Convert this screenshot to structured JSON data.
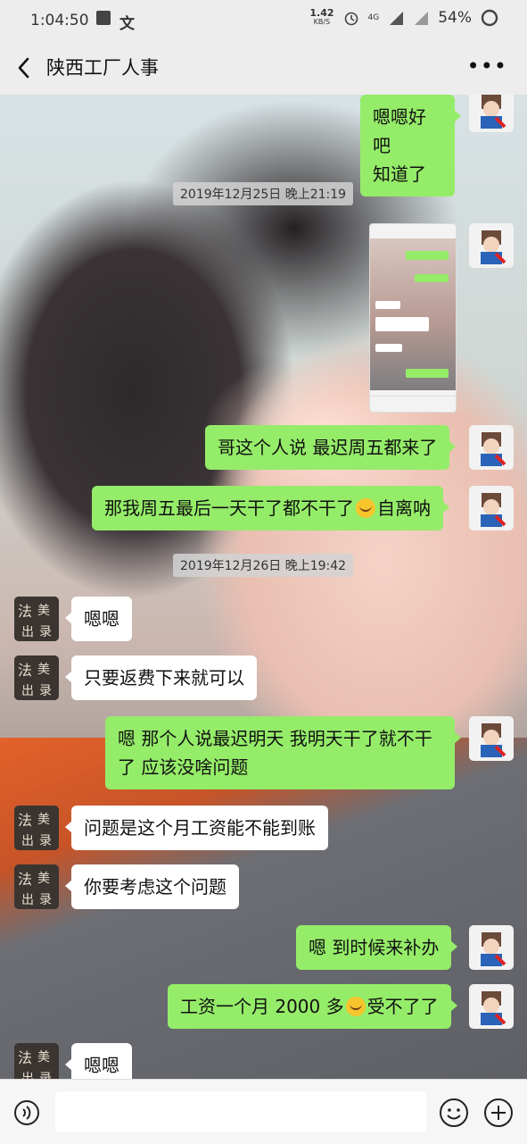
{
  "status_bar": {
    "time": "1:04:50",
    "net_speed": "1.42",
    "net_speed_unit": "KB/S",
    "network": "4G",
    "battery": "54%"
  },
  "header": {
    "title": "陕西工厂人事"
  },
  "messages": [
    {
      "type": "text",
      "side": "me",
      "lines": [
        "嗯嗯好吧",
        "知道了"
      ]
    },
    {
      "type": "timestamp",
      "text": "2019年12月25日 晚上21:19"
    },
    {
      "type": "image",
      "side": "me"
    },
    {
      "type": "text",
      "side": "me",
      "lines": [
        "哥这个人说 最迟周五都来了"
      ]
    },
    {
      "type": "text",
      "side": "me",
      "text_before_emoji": "那我周五最后一天干了都不干了",
      "text_after_emoji": "自离呐",
      "emoji": "sob-emoji"
    },
    {
      "type": "timestamp",
      "text": "2019年12月26日 晚上19:42"
    },
    {
      "type": "text",
      "side": "them",
      "lines": [
        "嗯嗯"
      ]
    },
    {
      "type": "text",
      "side": "them",
      "lines": [
        "只要返费下来就可以"
      ]
    },
    {
      "type": "text",
      "side": "me",
      "lines": [
        "嗯 那个人说最迟明天 我明天干了就不干",
        "了  应该没啥问题"
      ]
    },
    {
      "type": "text",
      "side": "them",
      "lines": [
        "问题是这个月工资能不能到账"
      ]
    },
    {
      "type": "text",
      "side": "them",
      "lines": [
        "你要考虑这个问题"
      ]
    },
    {
      "type": "text",
      "side": "me",
      "lines": [
        "嗯  到时候来补办"
      ]
    },
    {
      "type": "text",
      "side": "me",
      "text_before_emoji": "工资一个月 2000 多",
      "text_after_emoji": "受不了了",
      "emoji": "sob-emoji"
    },
    {
      "type": "text",
      "side": "them",
      "lines": [
        "嗯嗯"
      ]
    }
  ],
  "input_bar": {
    "placeholder": ""
  }
}
